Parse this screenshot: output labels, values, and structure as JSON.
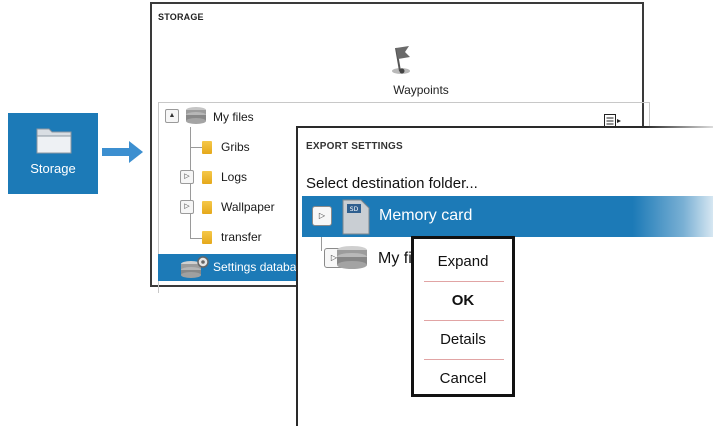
{
  "storage_tile": {
    "label": "Storage",
    "icon": "folder-icon"
  },
  "storage_panel": {
    "title": "STORAGE",
    "waypoints_label": "Waypoints",
    "tree": {
      "root": "My files",
      "children": [
        "Gribs",
        "Logs",
        "Wallpaper",
        "transfer"
      ],
      "selected": "Settings database"
    }
  },
  "export_panel": {
    "title": "EXPORT SETTINGS",
    "subtitle": "Select destination folder...",
    "rows": [
      "Memory card",
      "My files"
    ]
  },
  "context_menu": {
    "items": [
      "Expand",
      "OK",
      "Details",
      "Cancel"
    ]
  },
  "colors": {
    "accent": "#1c7ab7",
    "folder": "#f5c84a"
  }
}
